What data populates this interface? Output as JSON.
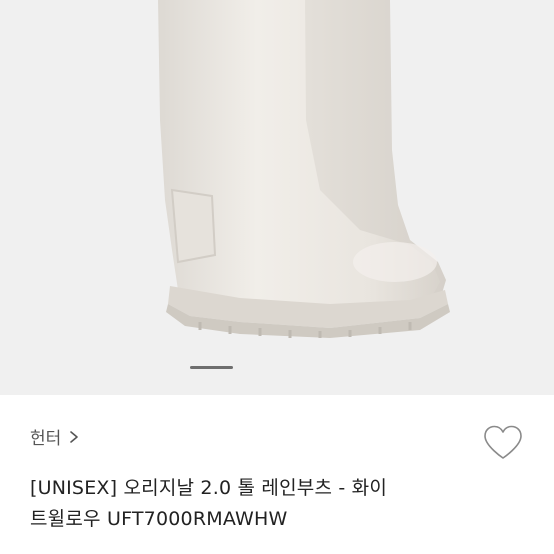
{
  "product": {
    "brand": "헌터",
    "title_line1": "[UNISEX] 오리지날 2.0 톨 레인부츠 - 화이",
    "title_line2": "트윌로우 UFT7000RMAWHW"
  },
  "carousel": {
    "active_index": 0
  },
  "icons": {
    "brand_chevron": "chevron-right-icon",
    "like": "heart-outline-icon"
  },
  "colors": {
    "image_background": "#f0f0f0",
    "boot": "#ece9e4",
    "indicator": "#6e6e6e",
    "text_primary": "#222222",
    "text_secondary": "#555555"
  }
}
